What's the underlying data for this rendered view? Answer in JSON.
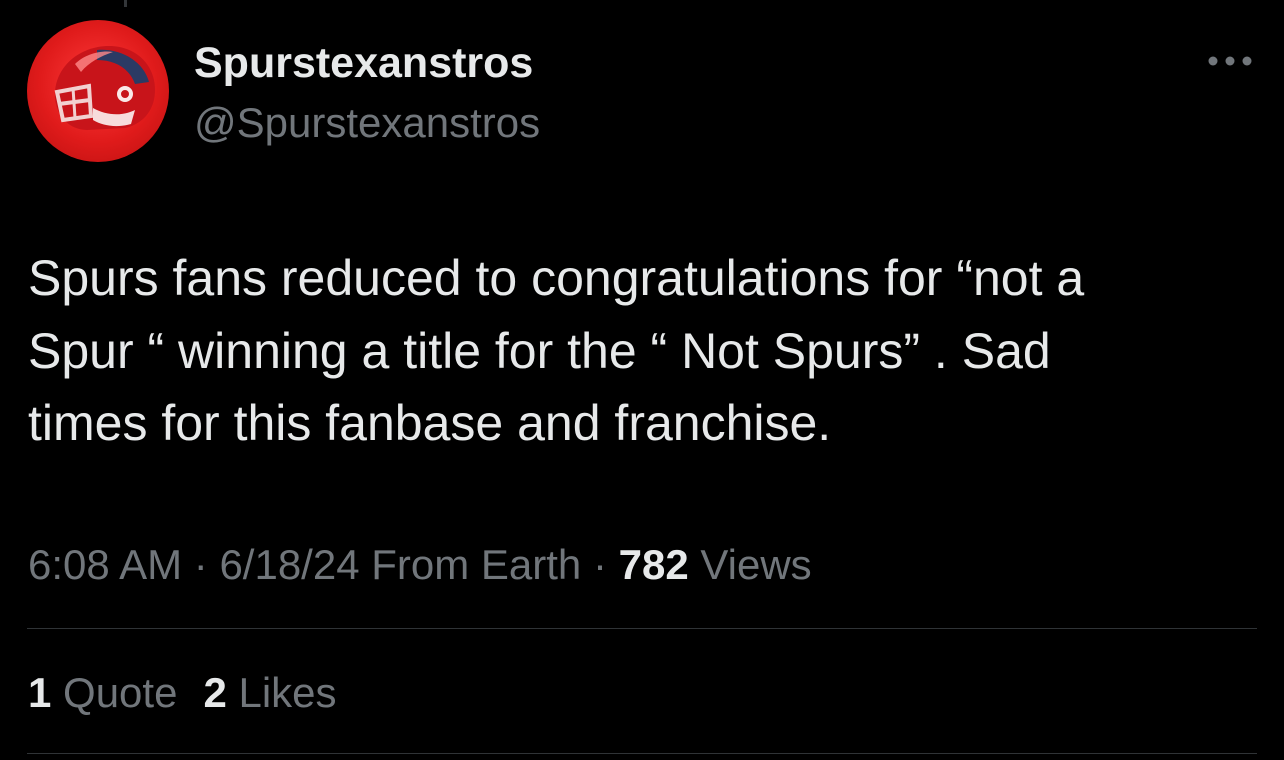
{
  "author": {
    "display_name": "Spurstexanstros",
    "handle": "@Spurstexanstros",
    "avatar_icon": "football-helmet-icon"
  },
  "more_icon": "more-options-icon",
  "tweet": {
    "text": "Spurs fans reduced to  congratulations for  “not a\nSpur “ winning a title for the “ Not Spurs” . Sad\ntimes for this fanbase and franchise."
  },
  "meta": {
    "time": "6:08 AM",
    "separator1": " · ",
    "date": "6/18/24",
    "source": " From Earth",
    "separator2": " · ",
    "views_count": "782",
    "views_label": " Views"
  },
  "stats": {
    "quotes_count": "1",
    "quotes_label": " Quote",
    "likes_count": "2",
    "likes_label": " Likes"
  },
  "colors": {
    "background": "#000000",
    "primary_text": "#e7e9ea",
    "secondary_text": "#71767b",
    "divider": "#2f3336",
    "avatar_red": "#e01b1b"
  }
}
